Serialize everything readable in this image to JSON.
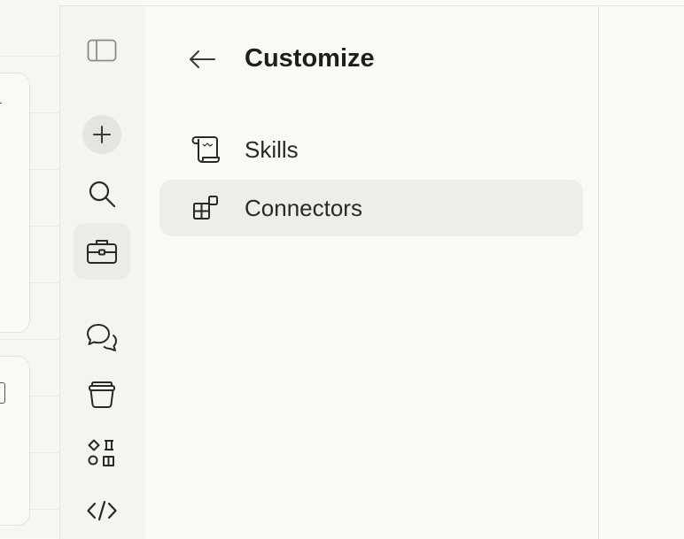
{
  "rail": {
    "items": [
      {
        "name": "sidebar-toggle",
        "icon": "sidebar-icon"
      },
      {
        "name": "new-chat",
        "icon": "plus-icon"
      },
      {
        "name": "search",
        "icon": "search-icon"
      },
      {
        "name": "customize",
        "icon": "briefcase-icon",
        "active": true
      },
      {
        "name": "chats",
        "icon": "chat-bubbles-icon"
      },
      {
        "name": "projects",
        "icon": "archive-icon"
      },
      {
        "name": "artifacts",
        "icon": "shapes-icon"
      },
      {
        "name": "code",
        "icon": "code-icon"
      }
    ]
  },
  "panel": {
    "title": "Customize",
    "back_icon": "arrow-left-icon",
    "items": [
      {
        "label": "Skills",
        "icon": "scroll-icon",
        "selected": false
      },
      {
        "label": "Connectors",
        "icon": "blocks-icon",
        "selected": true
      }
    ]
  },
  "colors": {
    "background": "#faf9f5",
    "rail": "#f5f4ef",
    "selected": "#efede7",
    "text": "#1f1e1b"
  }
}
